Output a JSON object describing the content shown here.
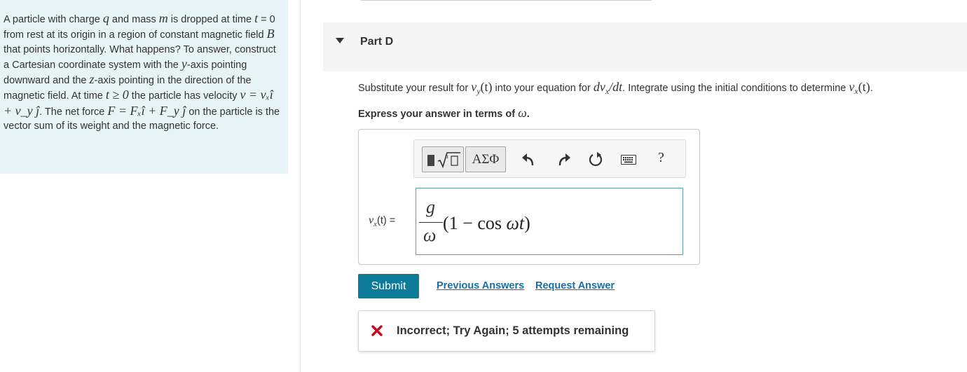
{
  "problem": {
    "text_1": "A particle with charge ",
    "var_q": "q",
    "text_2": " and mass ",
    "var_m": "m",
    "text_3": " is dropped at time ",
    "var_t1": "t",
    "text_4": " = 0 from rest at its origin in a region of constant magnetic field ",
    "var_B": "B",
    "text_5": " that points horizontally. What happens? To answer, construct a Cartesian coordinate system with the ",
    "var_y": "y",
    "text_6": "-axis pointing downward and the ",
    "var_z": "z",
    "text_7": "-axis pointing in the direction of the magnetic field. At time ",
    "var_t2": "t ≥ 0",
    "text_8": " the particle has velocity ",
    "velocity_eq": "v = vₓî + v_y ĵ",
    "text_9": ". The net force ",
    "force_eq": "F = Fₓî + F_y ĵ",
    "text_10": " on the particle is the vector sum of its weight and the magnetic force."
  },
  "part": {
    "title": "Part D"
  },
  "instruction": {
    "t1": "Substitute your result for ",
    "m1": "v",
    "m1_sub": "y",
    "m1_arg": "(t)",
    "t2": " into your equation for ",
    "m2": "dv",
    "m2_sub": "x",
    "m2_rest": "/dt",
    "t3": ". Integrate using the initial conditions to determine ",
    "m3": "v",
    "m3_sub": "x",
    "m3_arg": "(t)",
    "t4": "."
  },
  "express": {
    "text": "Express your answer in terms of ",
    "var": "ω",
    "end": "."
  },
  "toolbar": {
    "greek_label": "ΑΣΦ",
    "help_label": "?"
  },
  "answer": {
    "label_var": "v",
    "label_sub": "x",
    "label_rest": "(t) =",
    "num": "g",
    "den": "ω",
    "rest_open": "(1 − ",
    "rest_cos": "cos ",
    "rest_arg": "ωt",
    "rest_close": ")"
  },
  "actions": {
    "submit_label": "Submit",
    "previous_answers_label": "Previous Answers",
    "request_answer_label": "Request Answer"
  },
  "feedback": {
    "text": "Incorrect; Try Again; 5 attempts remaining"
  },
  "colors": {
    "panel_bg": "#e6f4f8",
    "submit_bg": "#0d7a99",
    "link": "#1a6ea8",
    "error": "#d0021b",
    "input_border": "#5a9bb0"
  }
}
